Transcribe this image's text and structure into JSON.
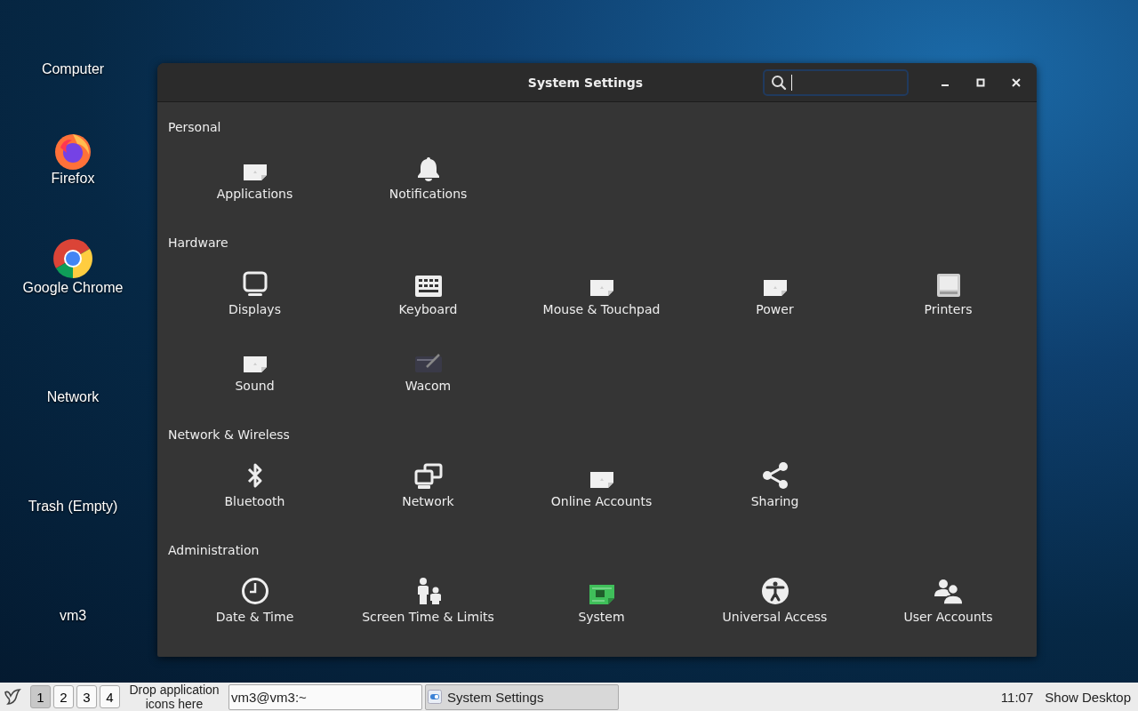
{
  "desktop_icons": [
    {
      "label": "Computer",
      "kind": "none"
    },
    {
      "label": "Firefox",
      "kind": "firefox"
    },
    {
      "label": "Google Chrome",
      "kind": "chrome"
    },
    {
      "label": "Network",
      "kind": "none"
    },
    {
      "label": "Trash (Empty)",
      "kind": "none"
    },
    {
      "label": "vm3",
      "kind": "none"
    }
  ],
  "window": {
    "title": "System Settings",
    "search": {
      "focused": true
    }
  },
  "sections": [
    {
      "title": "Personal",
      "items": [
        {
          "label": "Applications",
          "kind": "placeholder"
        },
        {
          "label": "Notifications",
          "kind": "bell"
        }
      ]
    },
    {
      "title": "Hardware",
      "items": [
        {
          "label": "Displays",
          "kind": "display"
        },
        {
          "label": "Keyboard",
          "kind": "keyboard"
        },
        {
          "label": "Mouse & Touchpad",
          "kind": "placeholder"
        },
        {
          "label": "Power",
          "kind": "placeholder"
        },
        {
          "label": "Printers",
          "kind": "printer"
        },
        {
          "label": "Sound",
          "kind": "placeholder"
        },
        {
          "label": "Wacom",
          "kind": "tablet"
        }
      ]
    },
    {
      "title": "Network & Wireless",
      "items": [
        {
          "label": "Bluetooth",
          "kind": "bluetooth"
        },
        {
          "label": "Network",
          "kind": "network"
        },
        {
          "label": "Online Accounts",
          "kind": "placeholder"
        },
        {
          "label": "Sharing",
          "kind": "share"
        }
      ]
    },
    {
      "title": "Administration",
      "items": [
        {
          "label": "Date & Time",
          "kind": "clock"
        },
        {
          "label": "Screen Time & Limits",
          "kind": "family"
        },
        {
          "label": "System",
          "kind": "chip"
        },
        {
          "label": "Universal Access",
          "kind": "access"
        },
        {
          "label": "User Accounts",
          "kind": "users"
        }
      ]
    }
  ],
  "taskbar": {
    "workspaces": [
      {
        "label": "1",
        "selected": true
      },
      {
        "label": "2",
        "selected": false
      },
      {
        "label": "3",
        "selected": false
      },
      {
        "label": "4",
        "selected": false
      }
    ],
    "drop_hint": "Drop application icons here",
    "tasks": [
      {
        "label": "vm3@vm3:~",
        "selected": false,
        "kind": "terminal"
      },
      {
        "label": "System Settings",
        "selected": true,
        "kind": "settings"
      }
    ],
    "clock": "11:07",
    "show_desktop": "Show Desktop"
  }
}
